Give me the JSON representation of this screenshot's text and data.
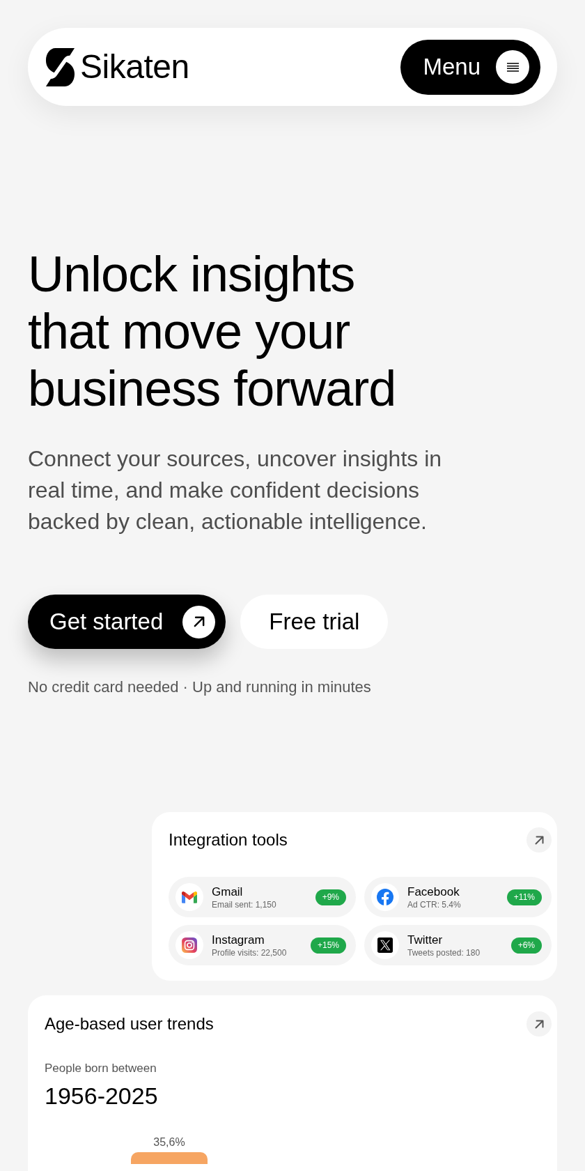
{
  "header": {
    "brand": "Sikaten",
    "menu_button": "Menu"
  },
  "hero": {
    "title": "Unlock insights that move your business forward",
    "subtitle": "Connect your sources, uncover insights in real time, and make confident decisions backed by clean, actionable intelligence.",
    "buttons": [
      {
        "kind": "primary",
        "label": "Get started"
      },
      {
        "kind": "secondary",
        "label": "Free trial"
      }
    ],
    "note": "No credit card needed · Up and running in minutes"
  },
  "integration_card": {
    "title": "Integration tools",
    "items": [
      {
        "kind": "gmail",
        "name": "Gmail",
        "detail": "Email sent: 1,150",
        "change": "+9%"
      },
      {
        "kind": "facebook",
        "name": "Facebook",
        "detail": "Ad CTR: 5.4%",
        "change": "+11%"
      },
      {
        "kind": "instagram",
        "name": "Instagram",
        "detail": "Profile visits: 22,500",
        "change": "+15%"
      },
      {
        "kind": "x",
        "name": "Twitter",
        "detail": "Tweets posted: 180",
        "change": "+6%"
      }
    ]
  },
  "age_card": {
    "title": "Age-based user trends",
    "label": "People born between",
    "range": "1956-2025",
    "bar_label": "35,6%"
  }
}
